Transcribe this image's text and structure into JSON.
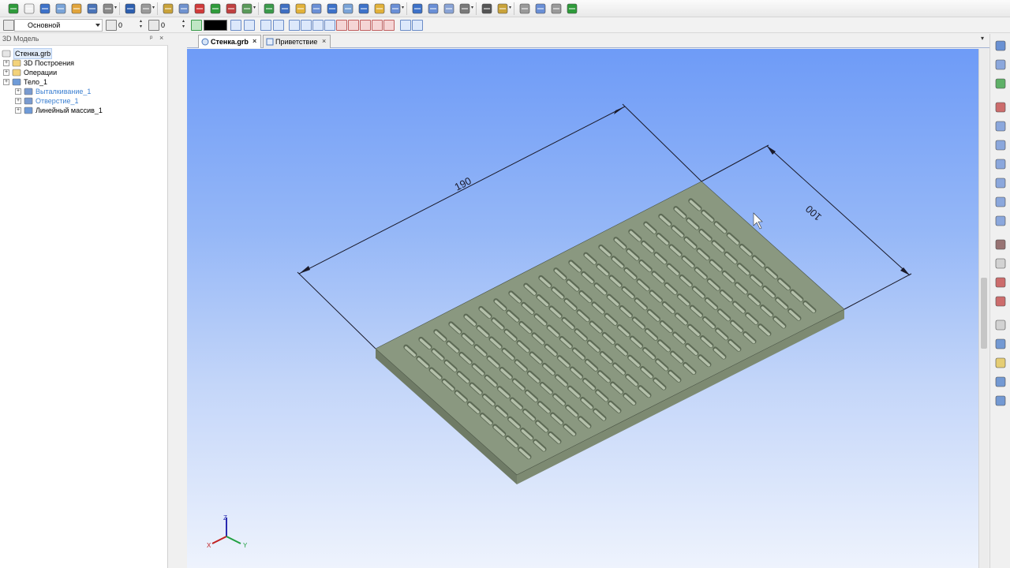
{
  "toolbar2": {
    "layer_combo": "Основной",
    "spin1_value": "0",
    "spin2_value": "0",
    "color_swatch": "#000000"
  },
  "left_panel": {
    "title": "3D Модель",
    "pin_glyph": "ᵖ",
    "close_glyph": "×",
    "tree": [
      {
        "label": "Стенка.grb",
        "level": 0,
        "style": "selected",
        "expander": ""
      },
      {
        "label": "3D Построения",
        "level": 1,
        "style": "normal",
        "expander": "+"
      },
      {
        "label": "Операции",
        "level": 1,
        "style": "normal",
        "expander": "+"
      },
      {
        "label": "Тело_1",
        "level": 1,
        "style": "normal",
        "expander": "+"
      },
      {
        "label": "Выталкивание_1",
        "level": 2,
        "style": "blue",
        "expander": "+"
      },
      {
        "label": "Отверстие_1",
        "level": 2,
        "style": "blue",
        "expander": "+"
      },
      {
        "label": "Линейный массив_1",
        "level": 2,
        "style": "normal",
        "expander": "+"
      }
    ]
  },
  "tabs": [
    {
      "label": "Стенка.grb",
      "active": true,
      "close": "×"
    },
    {
      "label": "Приветствие",
      "active": false,
      "close": "×"
    }
  ],
  "tab_menu_glyph": "▾",
  "model": {
    "dimension_length": "190",
    "dimension_width": "100",
    "plate_color": "#8a9880",
    "plate_side_color": "#6f7b66",
    "slot_rows": 10,
    "slot_cols": 20
  },
  "axis_triad": {
    "x": "X",
    "y": "Y",
    "z": "Z"
  }
}
